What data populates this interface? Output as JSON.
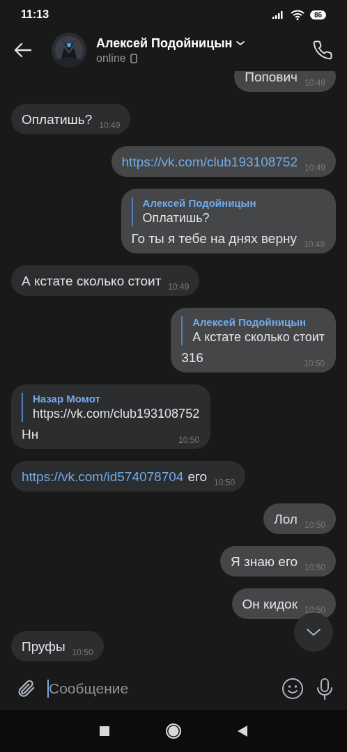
{
  "status_bar": {
    "time": "11:13",
    "battery": "86"
  },
  "header": {
    "name": "Алексей Подойницын",
    "status": "online"
  },
  "messages": [
    {
      "outgoing": true,
      "text": "Попович",
      "time": "10:49"
    },
    {
      "outgoing": false,
      "text": "Оплатишь?",
      "time": "10:49"
    },
    {
      "outgoing": true,
      "link": "https://vk.com/club193108752",
      "time": "10:49"
    },
    {
      "outgoing": true,
      "reply": {
        "author": "Алексей Подойницын",
        "text": "Оплатишь?"
      },
      "text": "Го ты я тебе на днях верну",
      "time": "10:49"
    },
    {
      "outgoing": false,
      "text": "А кстате сколько стоит",
      "time": "10:49"
    },
    {
      "outgoing": true,
      "reply": {
        "author": "Алексей Подойницын",
        "text": "А кстате сколько стоит"
      },
      "text": "316",
      "time": "10:50"
    },
    {
      "outgoing": false,
      "reply": {
        "author": "Назар Момот",
        "text": "https://vk.com/club193108752"
      },
      "text": "Нн",
      "time": "10:50"
    },
    {
      "outgoing": false,
      "link": "https://vk.com/id574078704",
      "text": "его",
      "time": "10:50"
    },
    {
      "outgoing": true,
      "text": "Лол",
      "time": "10:50"
    },
    {
      "outgoing": true,
      "text": "Я знаю его",
      "time": "10:50"
    },
    {
      "outgoing": true,
      "text": "Он кидок",
      "time": "10:50"
    },
    {
      "outgoing": false,
      "text": "Пруфы",
      "time": "10:50"
    }
  ],
  "composer": {
    "placeholder": "Сообщение"
  }
}
